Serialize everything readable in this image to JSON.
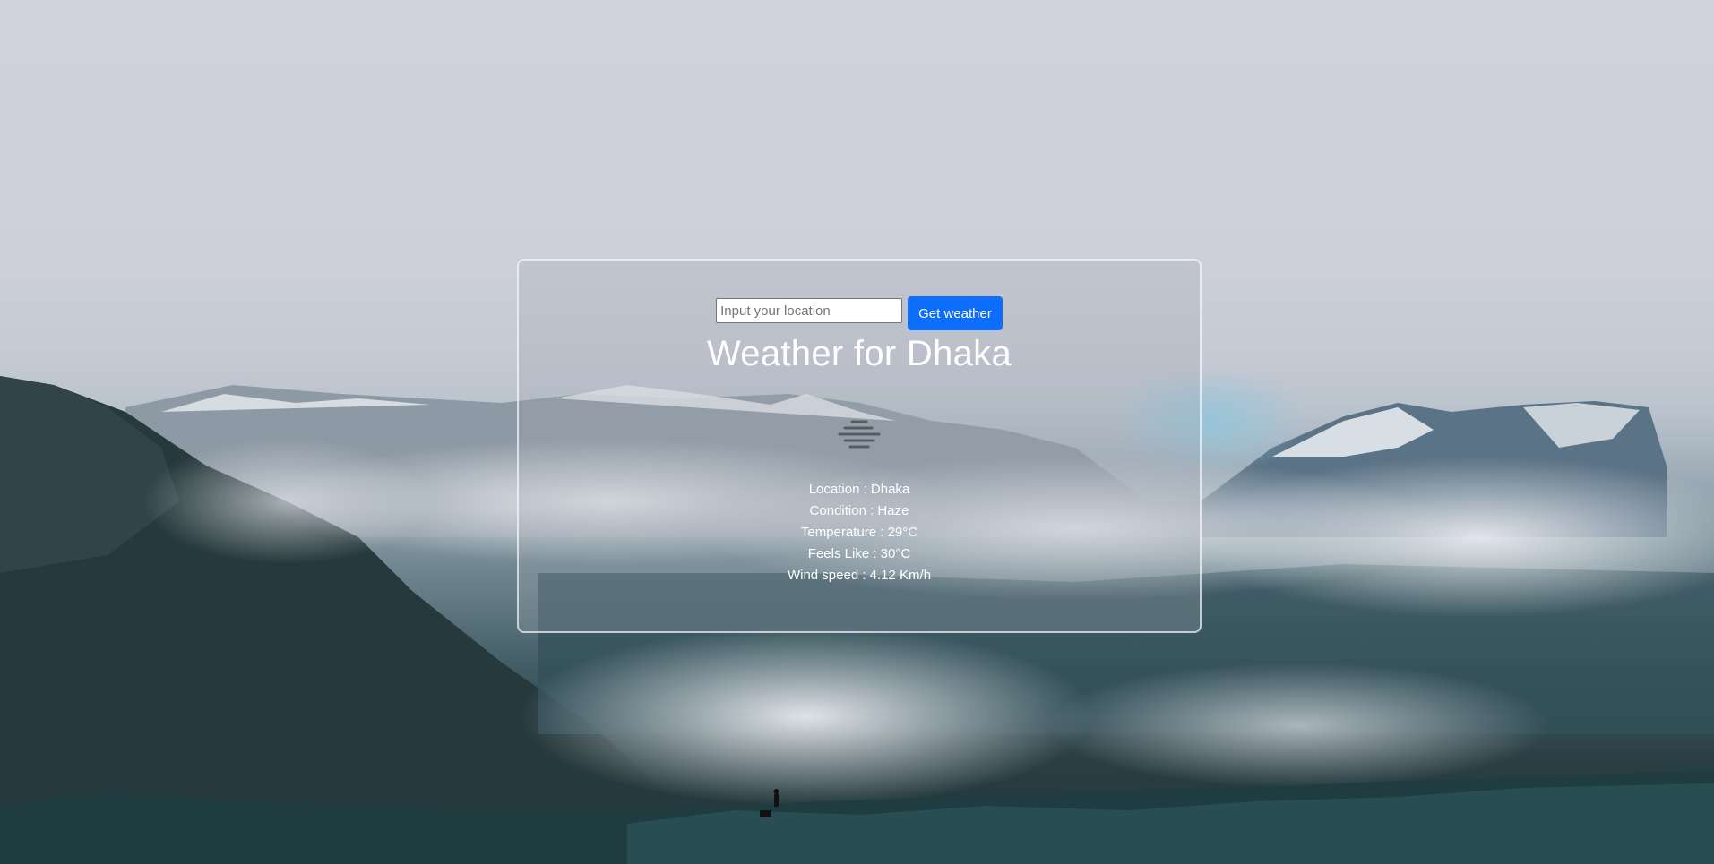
{
  "search": {
    "placeholder": "Input your location",
    "value": "",
    "button_label": "Get weather"
  },
  "title": "Weather for Dhaka",
  "weather_icon": "haze-icon",
  "details": {
    "location": "Location : Dhaka",
    "condition": "Condition : Haze",
    "temperature": "Temperature : 29°C",
    "feels_like": "Feels Like : 30°C",
    "wind_speed": "Wind speed : 4.12 Km/h"
  },
  "colors": {
    "button_bg": "#0d6efd",
    "text": "#ffffff"
  }
}
